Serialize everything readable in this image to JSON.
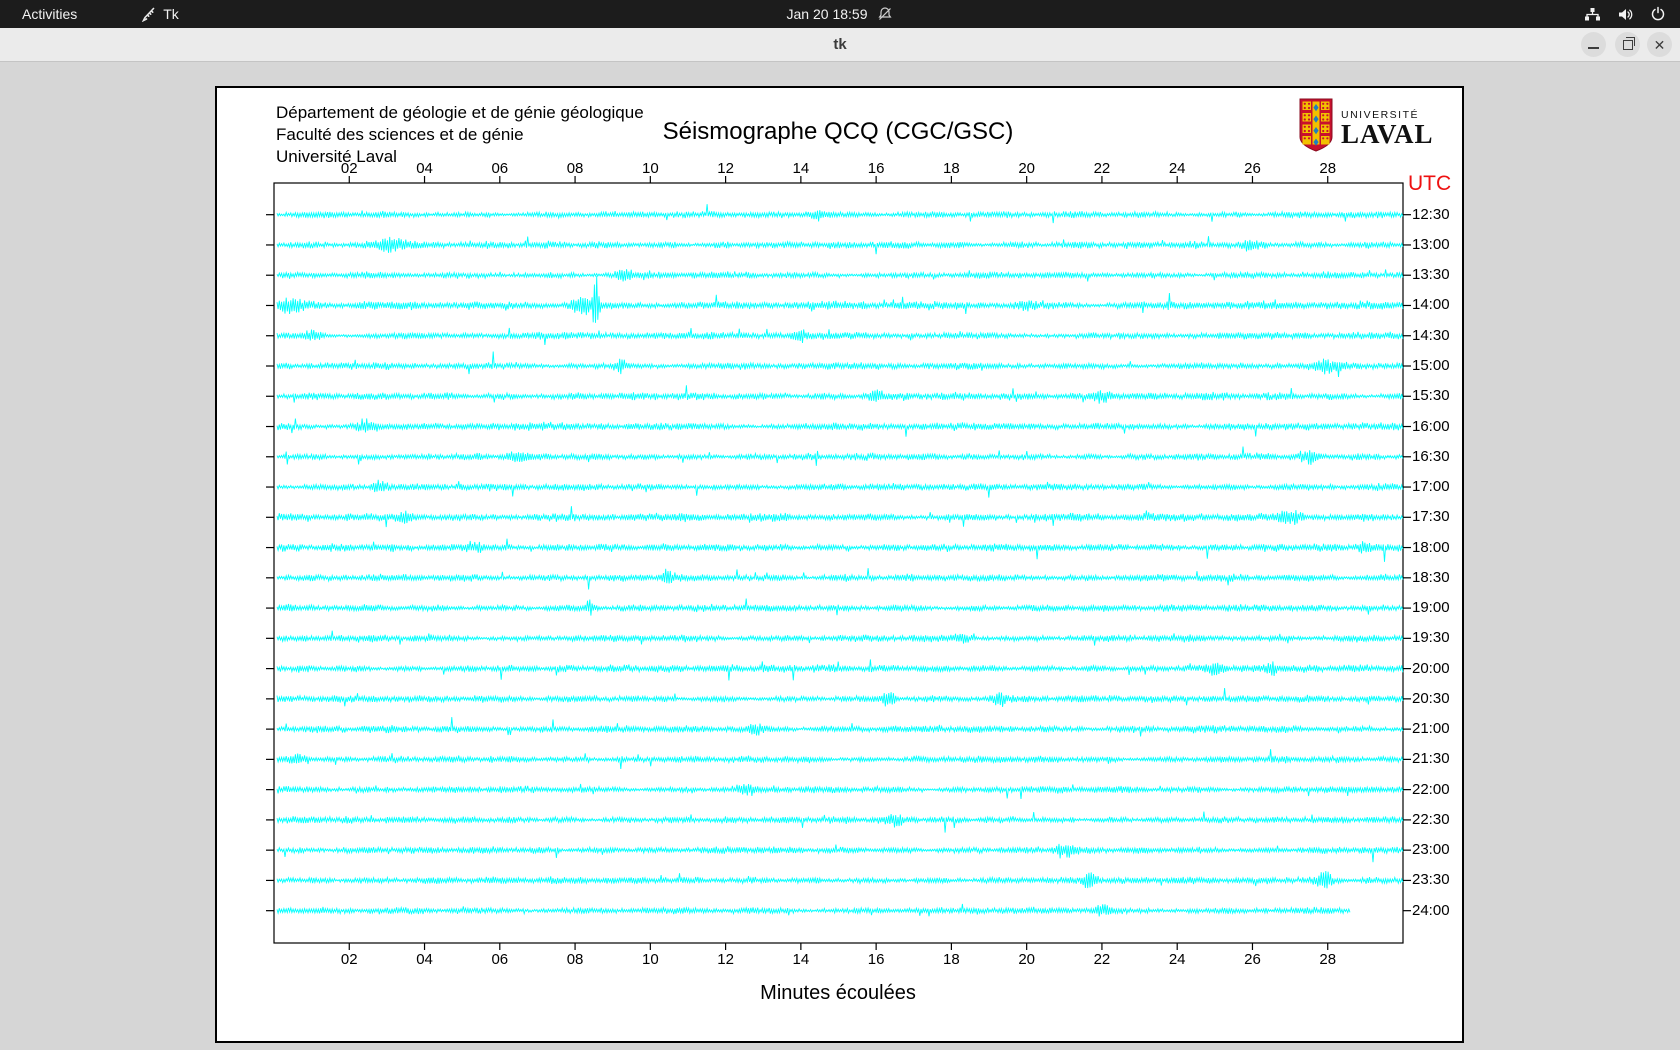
{
  "top_bar": {
    "activities_label": "Activities",
    "app_name": "Tk",
    "clock": "Jan 20  18:59",
    "icons": [
      "tk-feather-icon",
      "notifications-muted-bell-icon",
      "wired-network-icon",
      "volume-icon",
      "power-icon"
    ]
  },
  "title_bar": {
    "title": "tk",
    "buttons": [
      "minimize",
      "maximize",
      "close"
    ]
  },
  "canvas": {
    "header_lines": [
      "Département de géologie et de génie géologique",
      "Faculté des sciences et de génie",
      "Université Laval"
    ],
    "title": "Séismographe QCQ (CGC/GSC)",
    "utc_header": "UTC",
    "xaxis_title": "Minutes écoulées",
    "logo": {
      "university_word": "UNIVERSITÉ",
      "laval_word": "LAVAL"
    }
  },
  "chart_data": {
    "type": "line",
    "subtype": "helicorder-seismogram",
    "title": "Séismographe QCQ (CGC/GSC)",
    "xlabel": "Minutes écoulées",
    "x_range": [
      0,
      30
    ],
    "x_ticks": [
      "02",
      "04",
      "06",
      "08",
      "10",
      "12",
      "14",
      "16",
      "18",
      "20",
      "22",
      "24",
      "26",
      "28"
    ],
    "trace_color": "#00ffff",
    "frame_color": "#000000",
    "utc_axis_color": "#ee1111",
    "minutes_per_row": 30,
    "rows": [
      {
        "utc": "12:30",
        "seed": 101,
        "base": 2.6,
        "end": 30,
        "events": [
          {
            "min": 14.5,
            "amp": 4,
            "w": 0.5
          }
        ]
      },
      {
        "utc": "13:00",
        "seed": 207,
        "base": 2.8,
        "end": 30,
        "events": [
          {
            "min": 3.1,
            "amp": 6.5,
            "w": 0.8
          },
          {
            "min": 26,
            "amp": 4,
            "w": 0.4
          }
        ]
      },
      {
        "utc": "13:30",
        "seed": 311,
        "base": 2.6,
        "end": 30,
        "events": [
          {
            "min": 9.3,
            "amp": 5,
            "w": 0.3
          }
        ]
      },
      {
        "utc": "14:00",
        "seed": 421,
        "base": 3.4,
        "end": 30,
        "events": [
          {
            "min": 8.55,
            "amp": 30,
            "w": 0.12
          },
          {
            "min": 8.2,
            "amp": 7,
            "w": 0.5
          },
          {
            "min": 0.5,
            "amp": 5,
            "w": 0.6
          },
          {
            "min": 20,
            "amp": 4,
            "w": 0.3
          }
        ]
      },
      {
        "utc": "14:30",
        "seed": 523,
        "base": 2.9,
        "end": 30,
        "events": [
          {
            "min": 1,
            "amp": 5,
            "w": 0.4
          },
          {
            "min": 14,
            "amp": 4,
            "w": 0.3
          }
        ]
      },
      {
        "utc": "15:00",
        "seed": 613,
        "base": 2.7,
        "end": 30,
        "events": [
          {
            "min": 9.2,
            "amp": 6,
            "w": 0.25
          },
          {
            "min": 28,
            "amp": 5,
            "w": 0.5
          }
        ]
      },
      {
        "utc": "15:30",
        "seed": 727,
        "base": 3.0,
        "end": 30,
        "events": [
          {
            "min": 16,
            "amp": 5,
            "w": 0.3
          },
          {
            "min": 22,
            "amp": 6,
            "w": 0.4
          }
        ]
      },
      {
        "utc": "16:00",
        "seed": 821,
        "base": 3.1,
        "end": 30,
        "events": [
          {
            "min": 2.5,
            "amp": 5,
            "w": 0.5
          }
        ]
      },
      {
        "utc": "16:30",
        "seed": 907,
        "base": 2.7,
        "end": 30,
        "events": [
          {
            "min": 6.5,
            "amp": 4,
            "w": 0.4
          },
          {
            "min": 27.5,
            "amp": 5,
            "w": 0.4
          }
        ]
      },
      {
        "utc": "17:00",
        "seed": 113,
        "base": 2.8,
        "end": 30,
        "events": [
          {
            "min": 2.8,
            "amp": 5,
            "w": 0.3
          }
        ]
      },
      {
        "utc": "17:30",
        "seed": 219,
        "base": 3.3,
        "end": 30,
        "events": [
          {
            "min": 27,
            "amp": 6,
            "w": 0.5
          },
          {
            "min": 3.5,
            "amp": 4,
            "w": 0.4
          }
        ]
      },
      {
        "utc": "18:00",
        "seed": 331,
        "base": 3.1,
        "end": 30,
        "events": [
          {
            "min": 5.3,
            "amp": 5,
            "w": 0.4
          },
          {
            "min": 29,
            "amp": 5,
            "w": 0.3
          }
        ]
      },
      {
        "utc": "18:30",
        "seed": 433,
        "base": 2.9,
        "end": 30,
        "events": [
          {
            "min": 10.5,
            "amp": 4,
            "w": 0.3
          }
        ]
      },
      {
        "utc": "19:00",
        "seed": 541,
        "base": 2.8,
        "end": 30,
        "events": [
          {
            "min": 8.4,
            "amp": 6,
            "w": 0.2
          }
        ]
      },
      {
        "utc": "19:30",
        "seed": 641,
        "base": 2.8,
        "end": 30,
        "events": [
          {
            "min": 18.3,
            "amp": 5,
            "w": 0.3
          }
        ]
      },
      {
        "utc": "20:00",
        "seed": 743,
        "base": 3.0,
        "end": 30,
        "events": [
          {
            "min": 25,
            "amp": 5,
            "w": 0.4
          },
          {
            "min": 26.5,
            "amp": 5,
            "w": 0.3
          }
        ]
      },
      {
        "utc": "20:30",
        "seed": 839,
        "base": 2.8,
        "end": 30,
        "events": [
          {
            "min": 16.3,
            "amp": 6,
            "w": 0.3
          },
          {
            "min": 19.3,
            "amp": 5,
            "w": 0.3
          }
        ]
      },
      {
        "utc": "21:00",
        "seed": 941,
        "base": 2.9,
        "end": 30,
        "events": [
          {
            "min": 12.8,
            "amp": 4,
            "w": 0.3
          }
        ]
      },
      {
        "utc": "21:30",
        "seed": 149,
        "base": 2.7,
        "end": 30,
        "events": [
          {
            "min": 0.6,
            "amp": 5,
            "w": 0.4
          }
        ]
      },
      {
        "utc": "22:00",
        "seed": 251,
        "base": 2.7,
        "end": 30,
        "events": [
          {
            "min": 12.5,
            "amp": 4,
            "w": 0.3
          }
        ]
      },
      {
        "utc": "22:30",
        "seed": 353,
        "base": 2.7,
        "end": 30,
        "events": [
          {
            "min": 16.5,
            "amp": 4,
            "w": 0.3
          }
        ]
      },
      {
        "utc": "23:00",
        "seed": 457,
        "base": 2.7,
        "end": 30,
        "events": [
          {
            "min": 21,
            "amp": 5,
            "w": 0.4
          }
        ]
      },
      {
        "utc": "23:30",
        "seed": 563,
        "base": 2.7,
        "end": 30,
        "events": [
          {
            "min": 21.7,
            "amp": 9,
            "w": 0.25
          },
          {
            "min": 27.9,
            "amp": 8,
            "w": 0.3
          }
        ]
      },
      {
        "utc": "24:00",
        "seed": 661,
        "base": 2.6,
        "end": 28.6,
        "events": [
          {
            "min": 22,
            "amp": 5,
            "w": 0.3
          }
        ]
      }
    ]
  }
}
